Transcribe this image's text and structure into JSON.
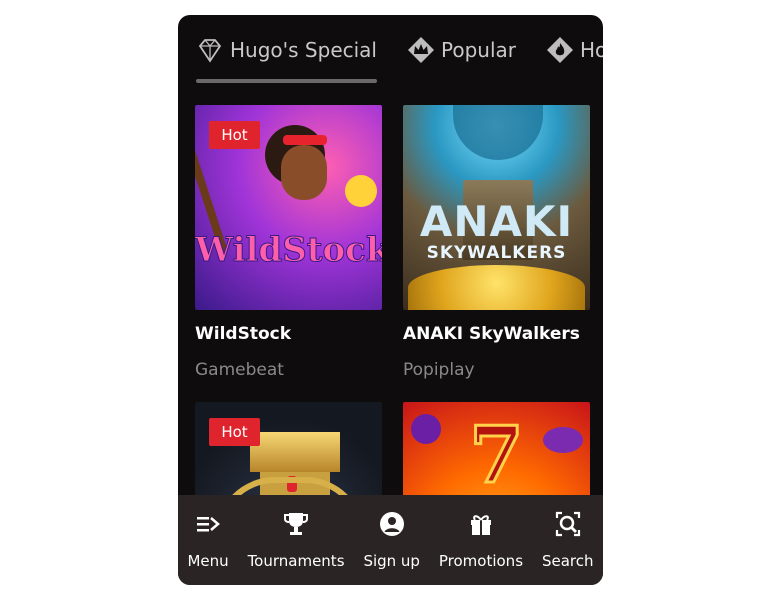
{
  "tabs": [
    {
      "label": "Hugo's Special",
      "icon": "diamond-icon"
    },
    {
      "label": "Popular",
      "icon": "crown-icon"
    },
    {
      "label": "Hot",
      "icon": "flame-icon"
    }
  ],
  "games": [
    {
      "title": "WildStock",
      "provider": "Gamebeat",
      "badge": "Hot",
      "art_text": "WildStock"
    },
    {
      "title": "ANAKI SkyWalkers",
      "provider": "Popiplay",
      "badge": "",
      "art_text": "ANAKI",
      "art_subtext": "SKYWALKERS"
    },
    {
      "title": "",
      "provider": "",
      "badge": "Hot"
    },
    {
      "title": "",
      "provider": "",
      "badge": "",
      "art_text": "7"
    }
  ],
  "nav": [
    {
      "label": "Menu",
      "icon": "menu-icon"
    },
    {
      "label": "Tournaments",
      "icon": "trophy-icon"
    },
    {
      "label": "Sign up",
      "icon": "user-icon"
    },
    {
      "label": "Promotions",
      "icon": "gift-icon"
    },
    {
      "label": "Search",
      "icon": "search-icon"
    }
  ],
  "colors": {
    "background": "#0e0c0c",
    "nav_background": "#2b2424",
    "badge": "#e0242d",
    "accent_underline": "#6a6a6a"
  }
}
